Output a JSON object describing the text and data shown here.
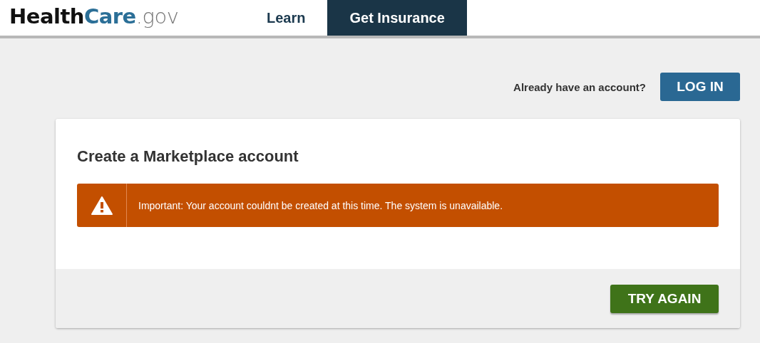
{
  "logo": {
    "parts": [
      {
        "text": "Health",
        "kind": "dark"
      },
      {
        "text": "Care",
        "kind": "accent"
      },
      {
        "text": ".gov",
        "kind": "light"
      }
    ]
  },
  "nav": [
    {
      "label": "Learn",
      "selected": false
    },
    {
      "label": "Get Insurance",
      "selected": true
    }
  ],
  "account_prompt": "Already have an account?",
  "login_button": "LOG IN",
  "card": {
    "title": "Create a Marketplace account",
    "alert": {
      "kind": "warning",
      "message": "Important: Your account couldnt be created at this time. The system is unavailable."
    },
    "button": "TRY AGAIN"
  }
}
